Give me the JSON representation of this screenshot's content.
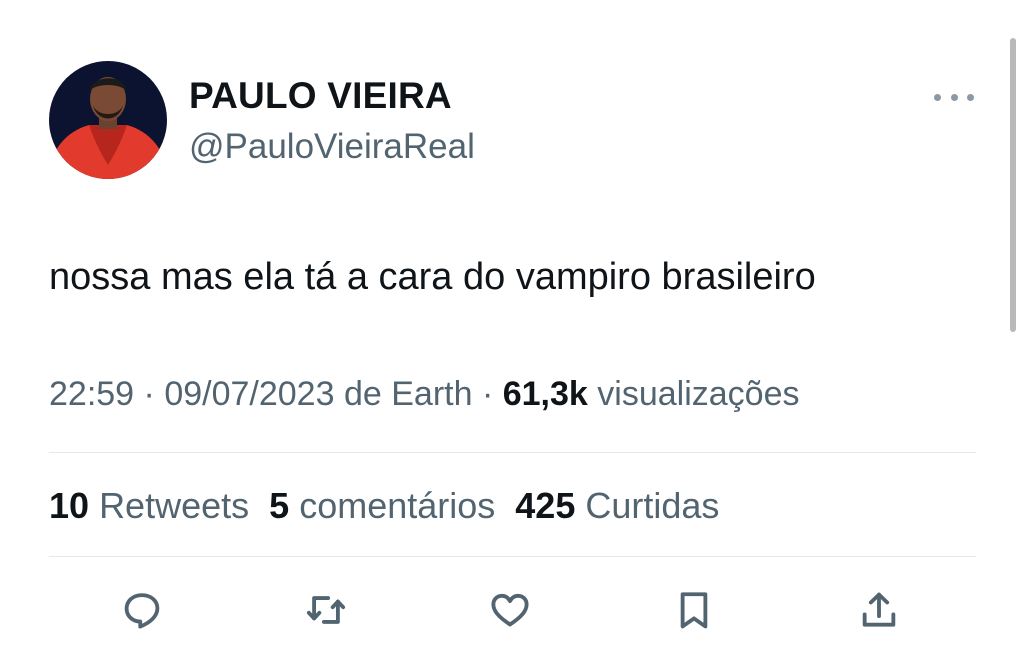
{
  "author": {
    "display_name": "PAULO VIEIRA",
    "handle": "@PauloVieiraReal"
  },
  "tweet": {
    "text": "nossa mas ela tá a cara do vampiro brasileiro"
  },
  "meta": {
    "time": "22:59",
    "date": "09/07/2023",
    "source_prefix": "de",
    "source": "Earth",
    "separator": "·",
    "views_count": "61,3k",
    "views_label": "visualizações"
  },
  "stats": {
    "retweets_count": "10",
    "retweets_label": "Retweets",
    "comments_count": "5",
    "comments_label": "comentários",
    "likes_count": "425",
    "likes_label": "Curtidas"
  },
  "icons": {
    "more": "more-horizontal-icon",
    "reply": "reply-icon",
    "retweet": "retweet-icon",
    "like": "heart-icon",
    "bookmark": "bookmark-icon",
    "share": "share-icon"
  },
  "colors": {
    "primary_text": "#0f1419",
    "secondary_text": "#536471",
    "divider": "#e6e9eb",
    "avatar_jacket": "#e23b2e",
    "avatar_background": "#0c1330"
  }
}
